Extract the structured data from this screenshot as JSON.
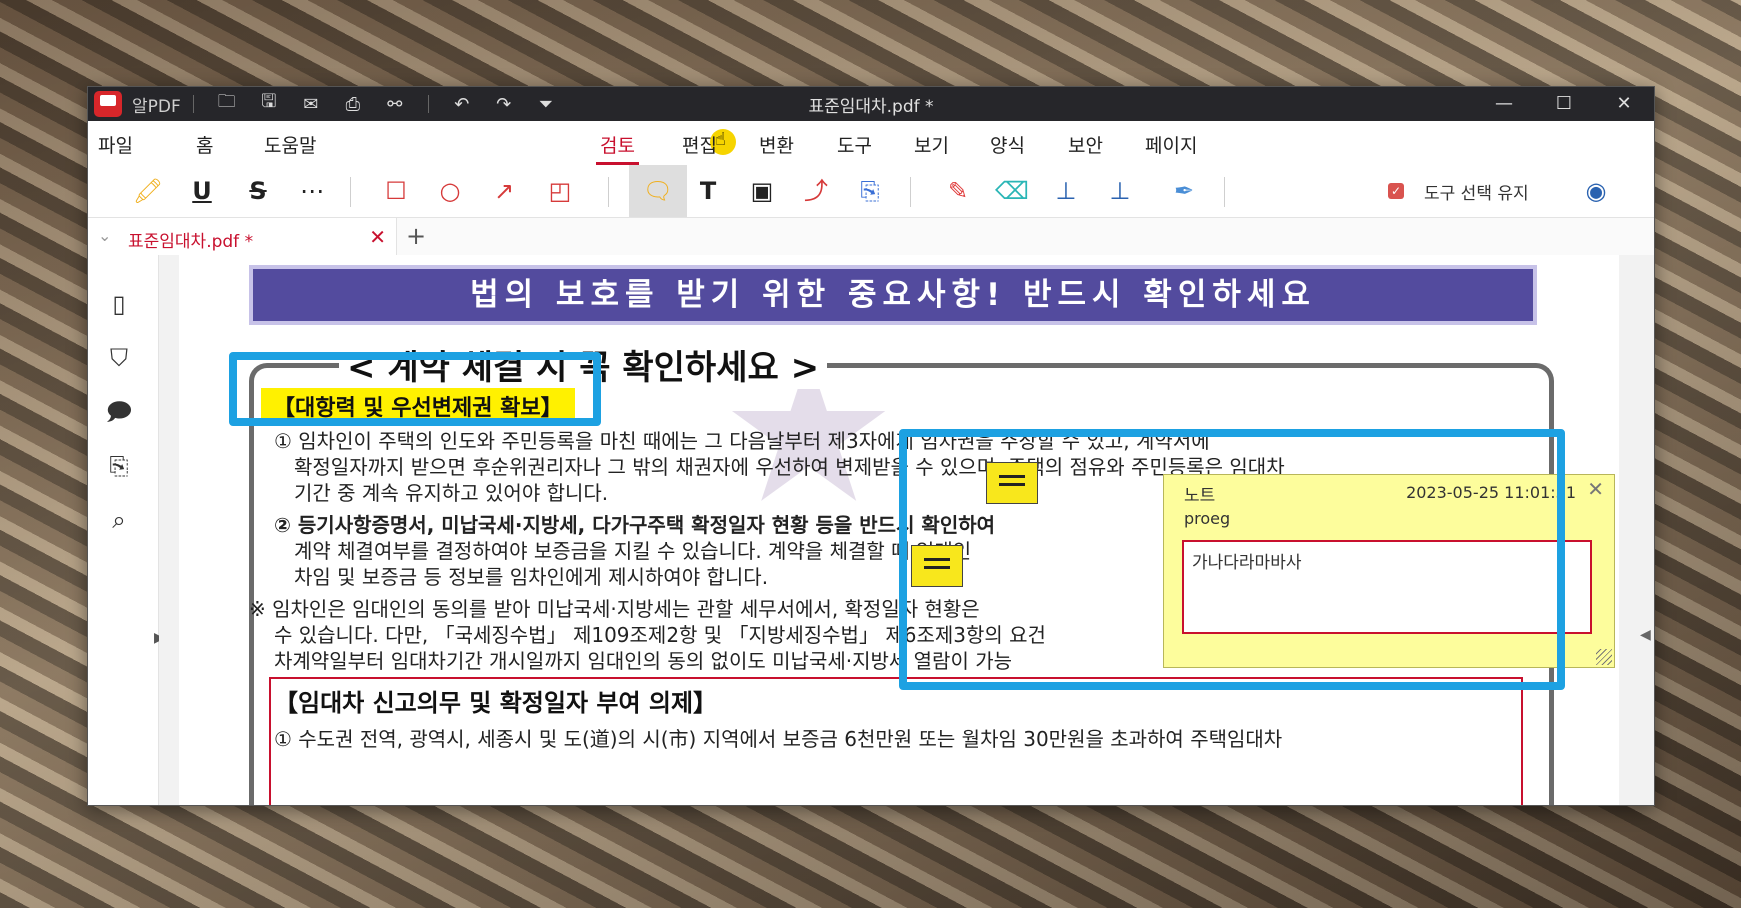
{
  "titlebar": {
    "app_name": "알PDF",
    "doc_title": "표준임대차.pdf *",
    "minimize": "—",
    "maximize": "☐",
    "close": "✕"
  },
  "menu": {
    "file": "파일",
    "home": "홈",
    "help": "도움말",
    "review": "검토",
    "edit": "편집",
    "convert": "변환",
    "tools": "도구",
    "view": "보기",
    "form": "양식",
    "security": "보안",
    "page": "페이지"
  },
  "toolbar": {
    "keep_tool_label": "도구 선택 유지"
  },
  "tab": {
    "name": "표준임대차.pdf *",
    "add": "+"
  },
  "document": {
    "banner": "법의 보호를 받기 위한 중요사항! 반드시 확인하세요",
    "section_heading": "< 계약 체결 시 꼭 확인하세요 >",
    "highlight": "【대항력 및 우선변제권 확보】",
    "p1_line1": "① 임차인이 주택의 인도와 주민등록을 마친 때에는 그 다음날부터 제3자에게 임차권을 주장할 수 있고, 계약서에",
    "p1_line2": "확정일자까지 받으면 후순위권리자나 그 밖의 채권자에 우선하여 변제받을 수 있으며, 주택의 점유와 주민등록은 임대차",
    "p1_line3": "기간 중 계속 유지하고 있어야 합니다.",
    "p2_line1": "② 등기사항증명서, 미납국세·지방세, 다가구주택 확정일자 현황 등을 반드시 확인하여",
    "p2_line2": "계약 체결여부를 결정하여야 보증금을 지킬 수 있습니다. 계약을 체결할 때 임대인",
    "p2_line3": "차임 및 보증금 등 정보를 임차인에게 제시하여야 합니다.",
    "p3_line1": "※ 임차인은 임대인의 동의를 받아 미납국세·지방세는 관할 세무서에서, 확정일자 현황은",
    "p3_line2": "수 있습니다. 다만, 「국세징수법」 제109조제2항 및 「지방세징수법」 제6조제3항의 요건",
    "p3_line3": "차계약일부터 임대차기간 개시일까지 임대인의 동의 없이도 미납국세·지방세 열람이 가능",
    "box_heading": "【임대차 신고의무 및 확정일자 부여 의제】",
    "box_line1": "① 수도권 전역, 광역시, 세종시 및 도(道)의 시(市) 지역에서 보증금 6천만원 또는 월차임 30만원을 초과하여 주택임대차"
  },
  "note": {
    "title": "노트",
    "date": "2023-05-25 11:01:51",
    "author": "proeg",
    "content": "가나다라마바사",
    "close": "✕"
  },
  "colors": {
    "accent": "#c8102e",
    "callout": "#1da1e2",
    "banner": "#534b9e",
    "note": "#fdfd9c"
  }
}
